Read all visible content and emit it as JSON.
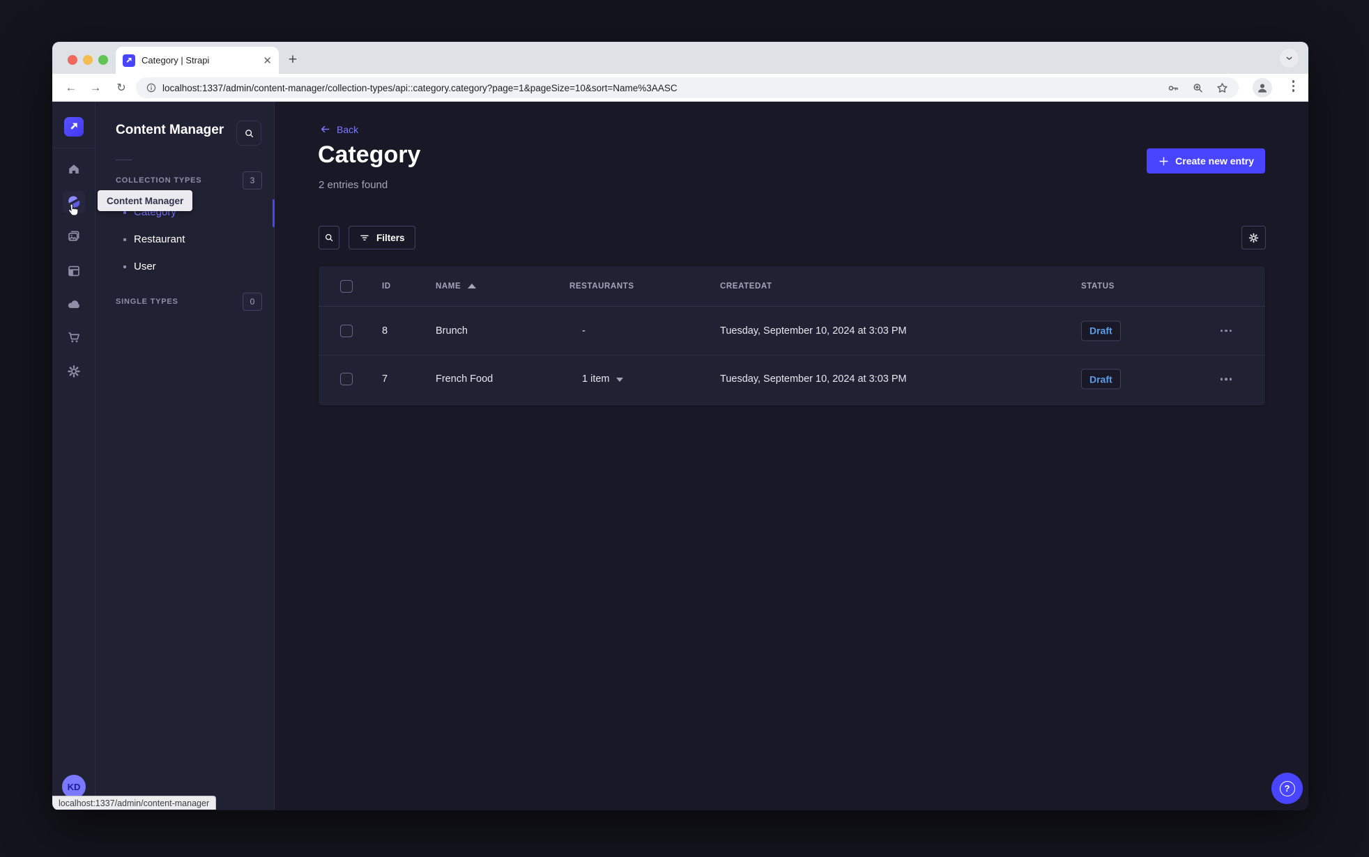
{
  "browser": {
    "tab_title": "Category | Strapi",
    "url": "localhost:1337/admin/content-manager/collection-types/api::category.category?page=1&pageSize=10&sort=Name%3AASC",
    "status_bar": "localhost:1337/admin/content-manager"
  },
  "rail": {
    "avatar_initials": "KD"
  },
  "sidebar": {
    "title": "Content Manager",
    "tooltip": "Content Manager",
    "collection_types": {
      "label": "COLLECTION TYPES",
      "badge": "3"
    },
    "single_types": {
      "label": "SINGLE TYPES",
      "badge": "0"
    },
    "items": [
      {
        "label": "Category",
        "active": true
      },
      {
        "label": "Restaurant",
        "active": false
      },
      {
        "label": "User",
        "active": false
      }
    ]
  },
  "main": {
    "back_label": "Back",
    "title": "Category",
    "subtitle": "2 entries found",
    "create_button_label": "Create new entry",
    "filters_button_label": "Filters",
    "table": {
      "headers": {
        "id": "ID",
        "name": "NAME",
        "restaurants": "RESTAURANTS",
        "createdat": "CREATEDAT",
        "status": "STATUS"
      },
      "sort": {
        "column": "NAME",
        "direction": "ASC"
      },
      "rows": [
        {
          "id": "8",
          "name": "Brunch",
          "restaurants": "-",
          "createdat": "Tuesday, September 10, 2024 at 3:03 PM",
          "status": "Draft"
        },
        {
          "id": "7",
          "name": "French Food",
          "restaurants": "1 item",
          "createdat": "Tuesday, September 10, 2024 at 3:03 PM",
          "status": "Draft"
        }
      ]
    }
  },
  "colors": {
    "primary": "#4945ff",
    "primary_light": "#7b79ff",
    "app_background": "#181826",
    "surface": "#212134",
    "draft_text": "#5e9de6"
  }
}
